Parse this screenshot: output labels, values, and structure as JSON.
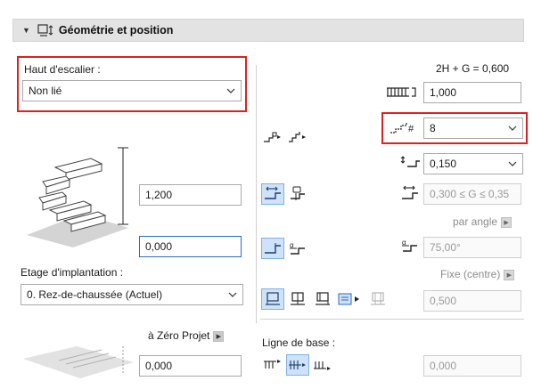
{
  "header": {
    "title": "Géométrie et position",
    "collapse_icon": "triangle-down-icon",
    "section_icon": "stair-geometry-icon"
  },
  "top": {
    "label": "Haut d'escalier :",
    "value": "Non lié"
  },
  "left": {
    "height_value": "1,200",
    "base_offset_value": "0,000",
    "story_label": "Etage d'implantation :",
    "story_value": "0. Rez-de-chaussée (Actuel)",
    "zero_label": "à Zéro Projet",
    "zero_value": "0,000"
  },
  "right": {
    "formula": "2H + G = 0,600",
    "riser_count_value": "1,000",
    "steps_value": "8",
    "riser_height_value": "0,150",
    "going_value": "0,300 ≤ G ≤ 0,35",
    "par_angle_label": "par angle",
    "angle_value": "75,00°",
    "fixe_label": "Fixe (centre)",
    "width_value": "0,500",
    "baseline_label": "Ligne de base :",
    "baseline_value": "0,000"
  },
  "colors": {
    "highlight": "#e02020",
    "selected_bg": "#cfe2f7",
    "accent": "#2a6bc7"
  }
}
